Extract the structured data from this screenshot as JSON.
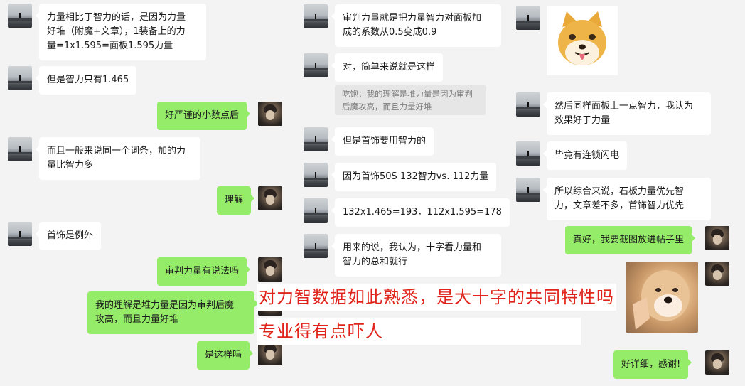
{
  "left_column": [
    {
      "side": "left",
      "text": "力量相比于智力的话，是因为力量\n好堆（附魔+文章），1装备上的力\n量=1x1.595=面板1.595力量"
    },
    {
      "side": "left",
      "text": "但是智力只有1.465"
    },
    {
      "side": "right",
      "text": "好严谨的小数点后"
    },
    {
      "side": "left",
      "text": "而且一般来说同一个词条，加的力\n量比智力多"
    },
    {
      "side": "right",
      "text": "理解"
    },
    {
      "side": "left",
      "text": "首饰是例外"
    },
    {
      "side": "right",
      "text": "审判力量有说法吗"
    },
    {
      "side": "right",
      "text": "我的理解是堆力量是因为审判后魔\n攻高，而且力量好堆"
    },
    {
      "side": "right",
      "text": "是这样吗"
    }
  ],
  "middle_column": [
    {
      "side": "left",
      "text": "审判力量就是把力量智力对面板加\n成的系数从0.5变成0.9"
    },
    {
      "side": "left",
      "text": "对，简单来说就是这样"
    },
    {
      "quote": "吃饱：我的理解是堆力量是因为审判\n后魔攻高，而且力量好堆"
    },
    {
      "side": "left",
      "text": "但是首饰要用智力的"
    },
    {
      "side": "left",
      "text": "因为首饰50S 132智力vs. 112力量"
    },
    {
      "side": "left",
      "text": "132x1.465=193，112x1.595=178"
    },
    {
      "side": "left",
      "text": "用来的说，我认为，十字看力量和\n智力的总和就行"
    }
  ],
  "right_column": [
    {
      "sticker": "doge-sticker"
    },
    {
      "side": "left",
      "text": "然后同样面板上一点智力，我认为\n效果好于力量"
    },
    {
      "side": "left",
      "text": "毕竟有连锁闪电"
    },
    {
      "side": "left",
      "text": "所以综合来说，石板力量优先智\n力，文章差不多，首饰智力优先"
    },
    {
      "side": "right",
      "text": "真好，我要截图放进帖子里"
    },
    {
      "sticker": "shiba-sticker"
    },
    {
      "side": "right",
      "text": "好详细，感谢!"
    }
  ],
  "overlay": {
    "line1": "对力智数据如此熟悉，是大十字的共同特性吗",
    "line2": "专业得有点吓人"
  },
  "colors": {
    "self_bubble": "#95ec69",
    "other_bubble": "#ffffff",
    "overlay_text": "#e0241b",
    "background": "#f3f3f3"
  }
}
